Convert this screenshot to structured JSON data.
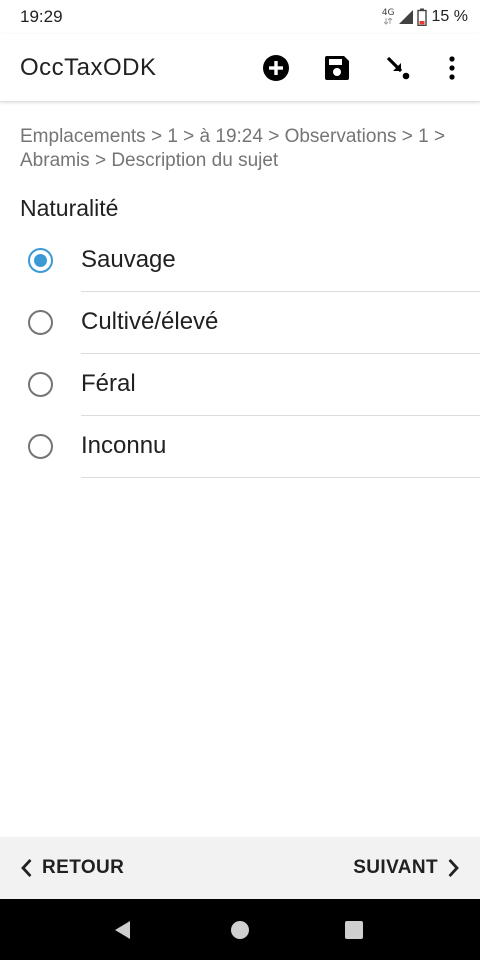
{
  "status_bar": {
    "time": "19:29",
    "network": "4G",
    "battery": "15 %"
  },
  "app_bar": {
    "title": "OccTaxODK",
    "actions": [
      {
        "icon": "add-circle-icon"
      },
      {
        "icon": "save-icon"
      },
      {
        "icon": "jump-to-icon"
      },
      {
        "icon": "more-vert-icon"
      }
    ]
  },
  "form": {
    "breadcrumb": "Emplacements > 1 > à 19:24 > Observations > 1 > Abramis > Description du sujet",
    "question": "Naturalité",
    "selected_index": 0,
    "options": [
      {
        "label": "Sauvage",
        "selected": true
      },
      {
        "label": "Cultivé/élevé",
        "selected": false
      },
      {
        "label": "Féral",
        "selected": false
      },
      {
        "label": "Inconnu",
        "selected": false
      }
    ]
  },
  "navigation": {
    "back_label": "RETOUR",
    "next_label": "SUIVANT"
  },
  "colors": {
    "accent": "#3b9ad6",
    "nav_background": "#f2f2f2",
    "system_nav": "#000000"
  }
}
